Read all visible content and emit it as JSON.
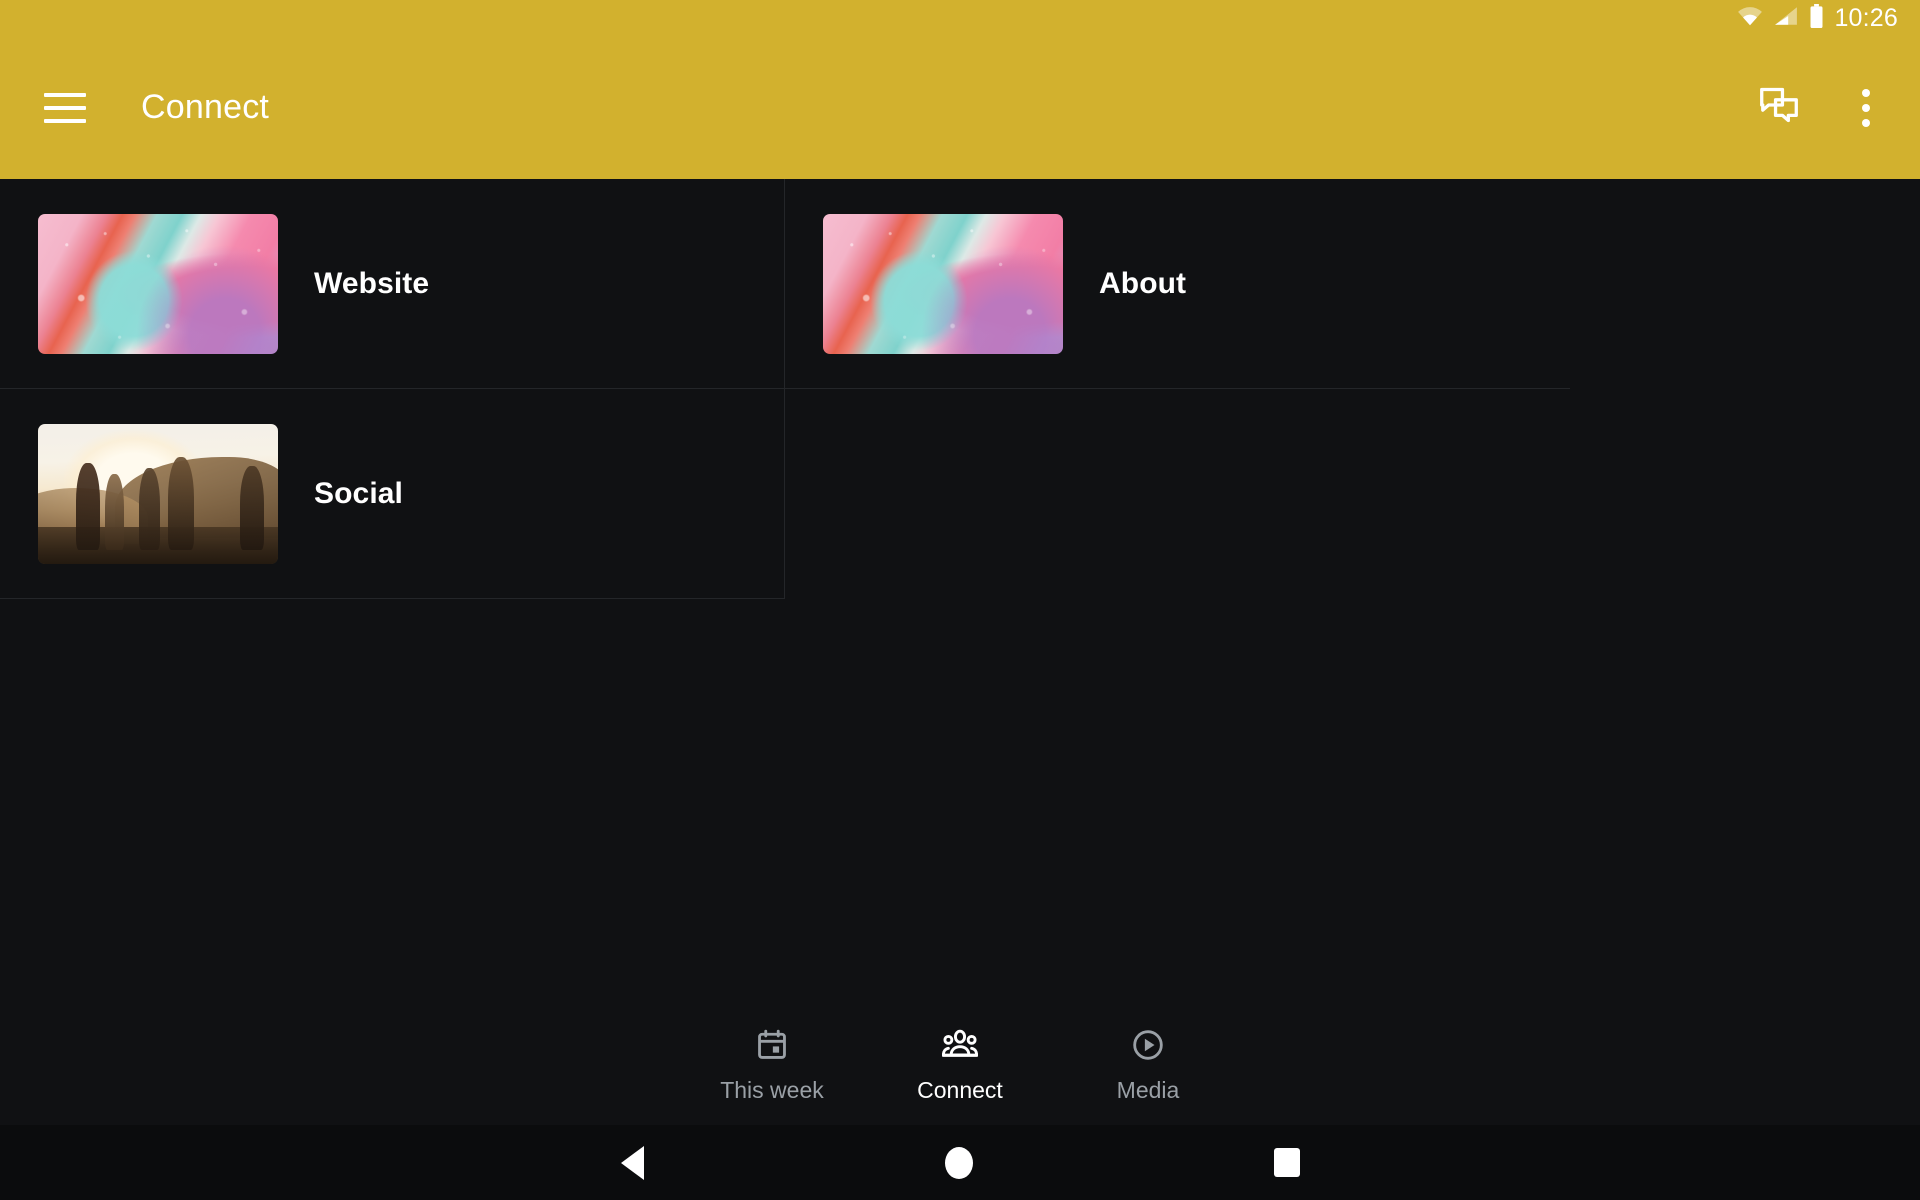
{
  "status_bar": {
    "time": "10:26",
    "icons": [
      "wifi-icon",
      "cell-signal-icon",
      "battery-icon"
    ]
  },
  "app_bar": {
    "menu_icon": "hamburger-menu-icon",
    "title": "Connect",
    "actions": [
      {
        "icon": "forum-chat-icon",
        "name": "messages-button"
      },
      {
        "icon": "more-vert-icon",
        "name": "overflow-menu-button"
      }
    ],
    "background_color": "#D2B12E",
    "text_color": "#FFFFFF"
  },
  "main": {
    "background_color": "#101113",
    "divider_color": "#242629",
    "cells": [
      {
        "label": "Website",
        "thumb": "abstract-fluid-art"
      },
      {
        "label": "About",
        "thumb": "abstract-fluid-art"
      },
      {
        "label": "Social",
        "thumb": "sunset-group-photo"
      }
    ]
  },
  "tab_bar": {
    "tabs": [
      {
        "label": "This week",
        "icon": "calendar-icon",
        "active": false
      },
      {
        "label": "Connect",
        "icon": "people-group-icon",
        "active": true
      },
      {
        "label": "Media",
        "icon": "play-circle-icon",
        "active": false
      }
    ],
    "active_color": "#FFFFFF",
    "inactive_color": "#9AA0A6"
  },
  "system_nav": {
    "buttons": [
      {
        "name": "back-button",
        "icon": "triangle-back-icon"
      },
      {
        "name": "home-button",
        "icon": "circle-home-icon"
      },
      {
        "name": "recents-button",
        "icon": "square-recents-icon"
      }
    ]
  }
}
